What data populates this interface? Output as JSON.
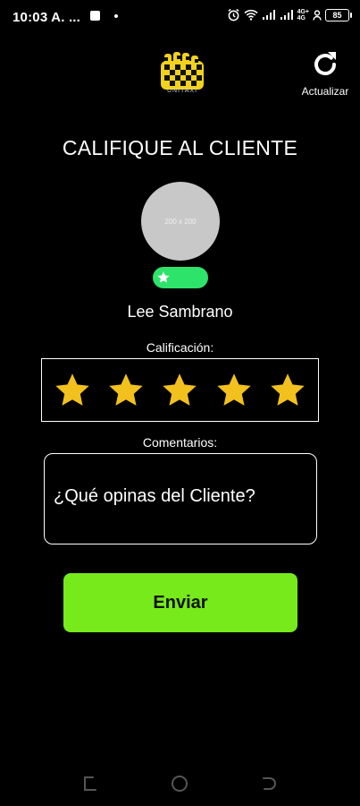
{
  "status_bar": {
    "time": "10:03 A. ...",
    "network_label_top": "4G+",
    "network_label_bottom": "4G",
    "battery": "85"
  },
  "header": {
    "logo_text": "UNITAXI",
    "refresh_label": "Actualizar",
    "refresh_icon": "refresh-icon"
  },
  "title": "CALIFIQUE AL CLIENTE",
  "client": {
    "avatar_placeholder": "200 x 200",
    "name": "Lee Sambrano",
    "badge_color": "#2ee36a"
  },
  "rating": {
    "label": "Calificación:",
    "stars": 5,
    "selected": 5,
    "star_color": "#f3c11d"
  },
  "comments": {
    "label": "Comentarios:",
    "placeholder": "¿Qué opinas del Cliente?"
  },
  "submit": {
    "label": "Enviar",
    "color": "#76ea1a"
  },
  "nav": {
    "recents_icon": "recents-icon",
    "home_icon": "home-icon",
    "back_icon": "back-icon"
  }
}
